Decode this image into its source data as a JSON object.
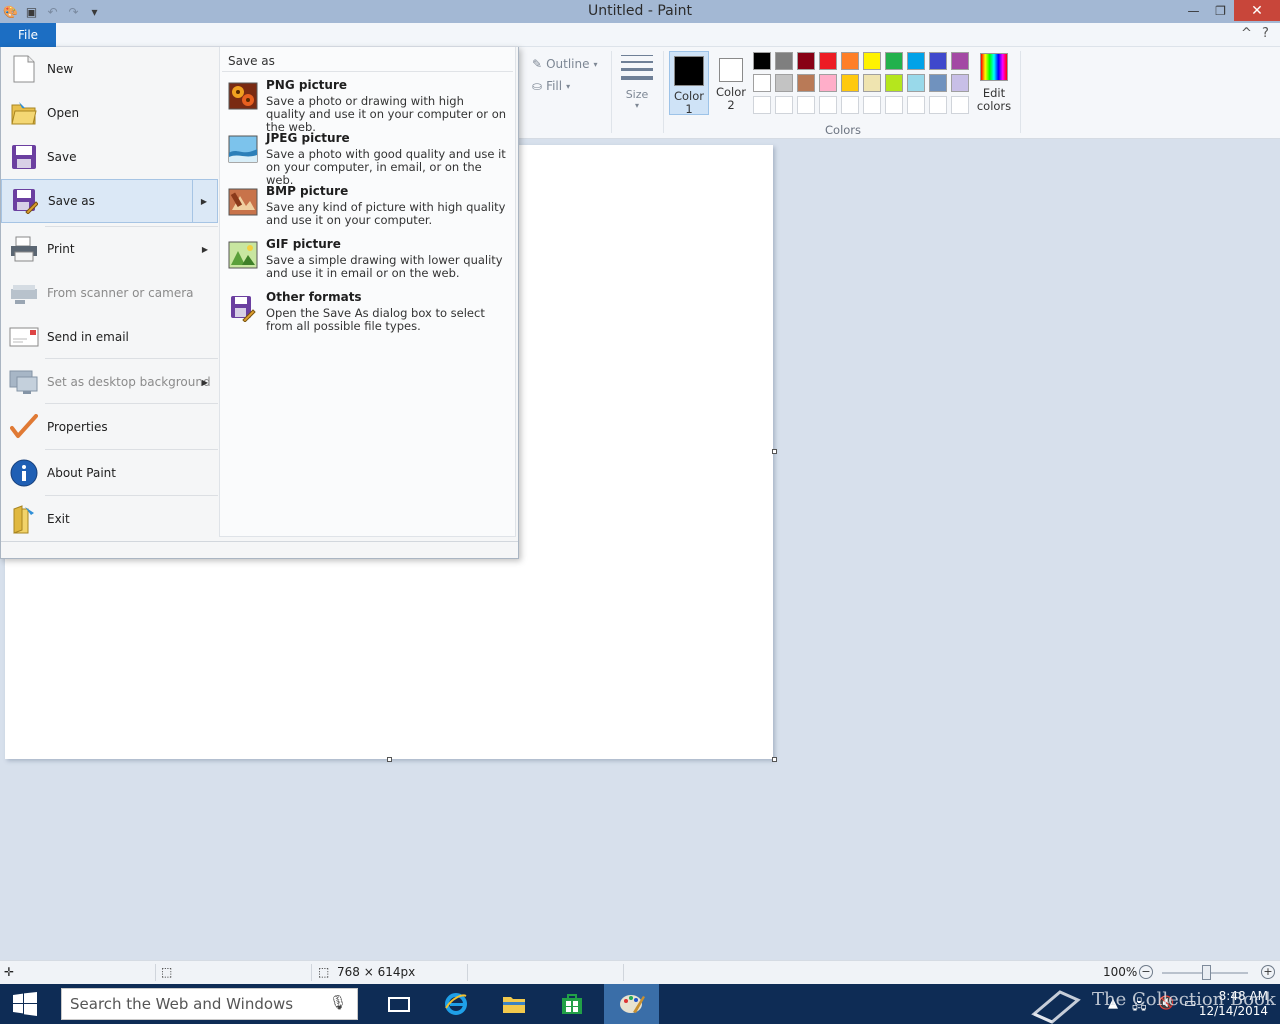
{
  "window": {
    "title": "Untitled - Paint"
  },
  "ribbon": {
    "file_tab": "File",
    "shapes": {
      "outline_label": "Outline",
      "fill_label": "Fill"
    },
    "size_label": "Size",
    "color1_label": "Color 1",
    "color2_label": "Color 2",
    "color1_value": "#000000",
    "color2_value": "#ffffff",
    "edit_colors_label": "Edit colors",
    "colors_group_label": "Colors",
    "palette_row1": [
      "#000000",
      "#7f7f7f",
      "#880015",
      "#ed1c24",
      "#ff7f27",
      "#fff200",
      "#22b14c",
      "#00a2e8",
      "#3f48cc",
      "#a349a4"
    ],
    "palette_row2": [
      "#ffffff",
      "#c3c3c3",
      "#b97a57",
      "#ffaec9",
      "#ffc90e",
      "#efe4b0",
      "#b5e61d",
      "#99d9ea",
      "#7092be",
      "#c8bfe7"
    ]
  },
  "file_menu": {
    "items": [
      {
        "label": "New",
        "icon": "new-document-icon"
      },
      {
        "label": "Open",
        "icon": "open-folder-icon"
      },
      {
        "label": "Save",
        "icon": "save-disk-icon"
      },
      {
        "label": "Save as",
        "icon": "save-as-icon"
      },
      {
        "label": "Print",
        "icon": "printer-icon"
      },
      {
        "label": "From scanner or camera",
        "icon": "scanner-icon"
      },
      {
        "label": "Send in email",
        "icon": "email-icon"
      },
      {
        "label": "Set as desktop background",
        "icon": "desktop-background-icon"
      },
      {
        "label": "Properties",
        "icon": "checkmark-icon"
      },
      {
        "label": "About Paint",
        "icon": "info-icon"
      },
      {
        "label": "Exit",
        "icon": "exit-icon"
      }
    ],
    "save_as_panel": {
      "heading": "Save as",
      "options": [
        {
          "title": "PNG picture",
          "description": "Save a photo or drawing with high quality and use it on your computer or on the web."
        },
        {
          "title": "JPEG picture",
          "description": "Save a photo with good quality and use it on your computer, in email, or on the web."
        },
        {
          "title": "BMP picture",
          "description": "Save any kind of picture with high quality and use it on your computer."
        },
        {
          "title": "GIF picture",
          "description": "Save a simple drawing with lower quality and use it in email or on the web."
        },
        {
          "title": "Other formats",
          "description": "Open the Save As dialog box to select from all possible file types."
        }
      ]
    }
  },
  "status_bar": {
    "canvas_size": "768 × 614px",
    "zoom": "100%",
    "zoom_level": 1.0
  },
  "taskbar": {
    "search_placeholder": "Search the Web and Windows",
    "time": "8:48 AM",
    "date": "12/14/2014"
  },
  "watermark": "The Collection Book"
}
